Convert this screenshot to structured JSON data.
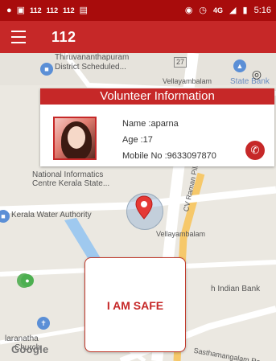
{
  "status_bar": {
    "left_icons": [
      "notification-icon",
      "screenshot-icon",
      "sim-112-icon",
      "sim-112-icon",
      "sim-112-icon",
      "news-icon"
    ],
    "sim_label": "112",
    "network": "4G",
    "time": "5:16"
  },
  "app_bar": {
    "title": "112",
    "menu_icon": "hamburger-menu-icon"
  },
  "map": {
    "labels": {
      "thiruvananthapuram": "Thiruvananthapuram",
      "district": "District Scheduled...",
      "vellayambalam_top": "Vellayambalam",
      "state_bank": "State Bank",
      "national_informatics": "National Informatics",
      "centre_kerala": "Centre Kerala State...",
      "kerala_water": "Kerala Water Authority",
      "cv_raman": "CV Raman Pillai R",
      "vellayambalam": "Vellayambalam",
      "indian_bank": "h Indian Bank",
      "maranatha": "laranatha",
      "church": "Church",
      "road_bottom": "Sasthamangalam Ro"
    },
    "road_number": "27",
    "google_logo": "Google"
  },
  "volunteer_card": {
    "header": "Volunteer Information",
    "name_line": "Name :aparna",
    "age_line": "Age :17",
    "mobile_line": "Mobile No :9633097870"
  },
  "safe_button": {
    "label": "I AM SAFE"
  },
  "colors": {
    "primary": "#c62828",
    "status_bar": "#a80c0c"
  }
}
